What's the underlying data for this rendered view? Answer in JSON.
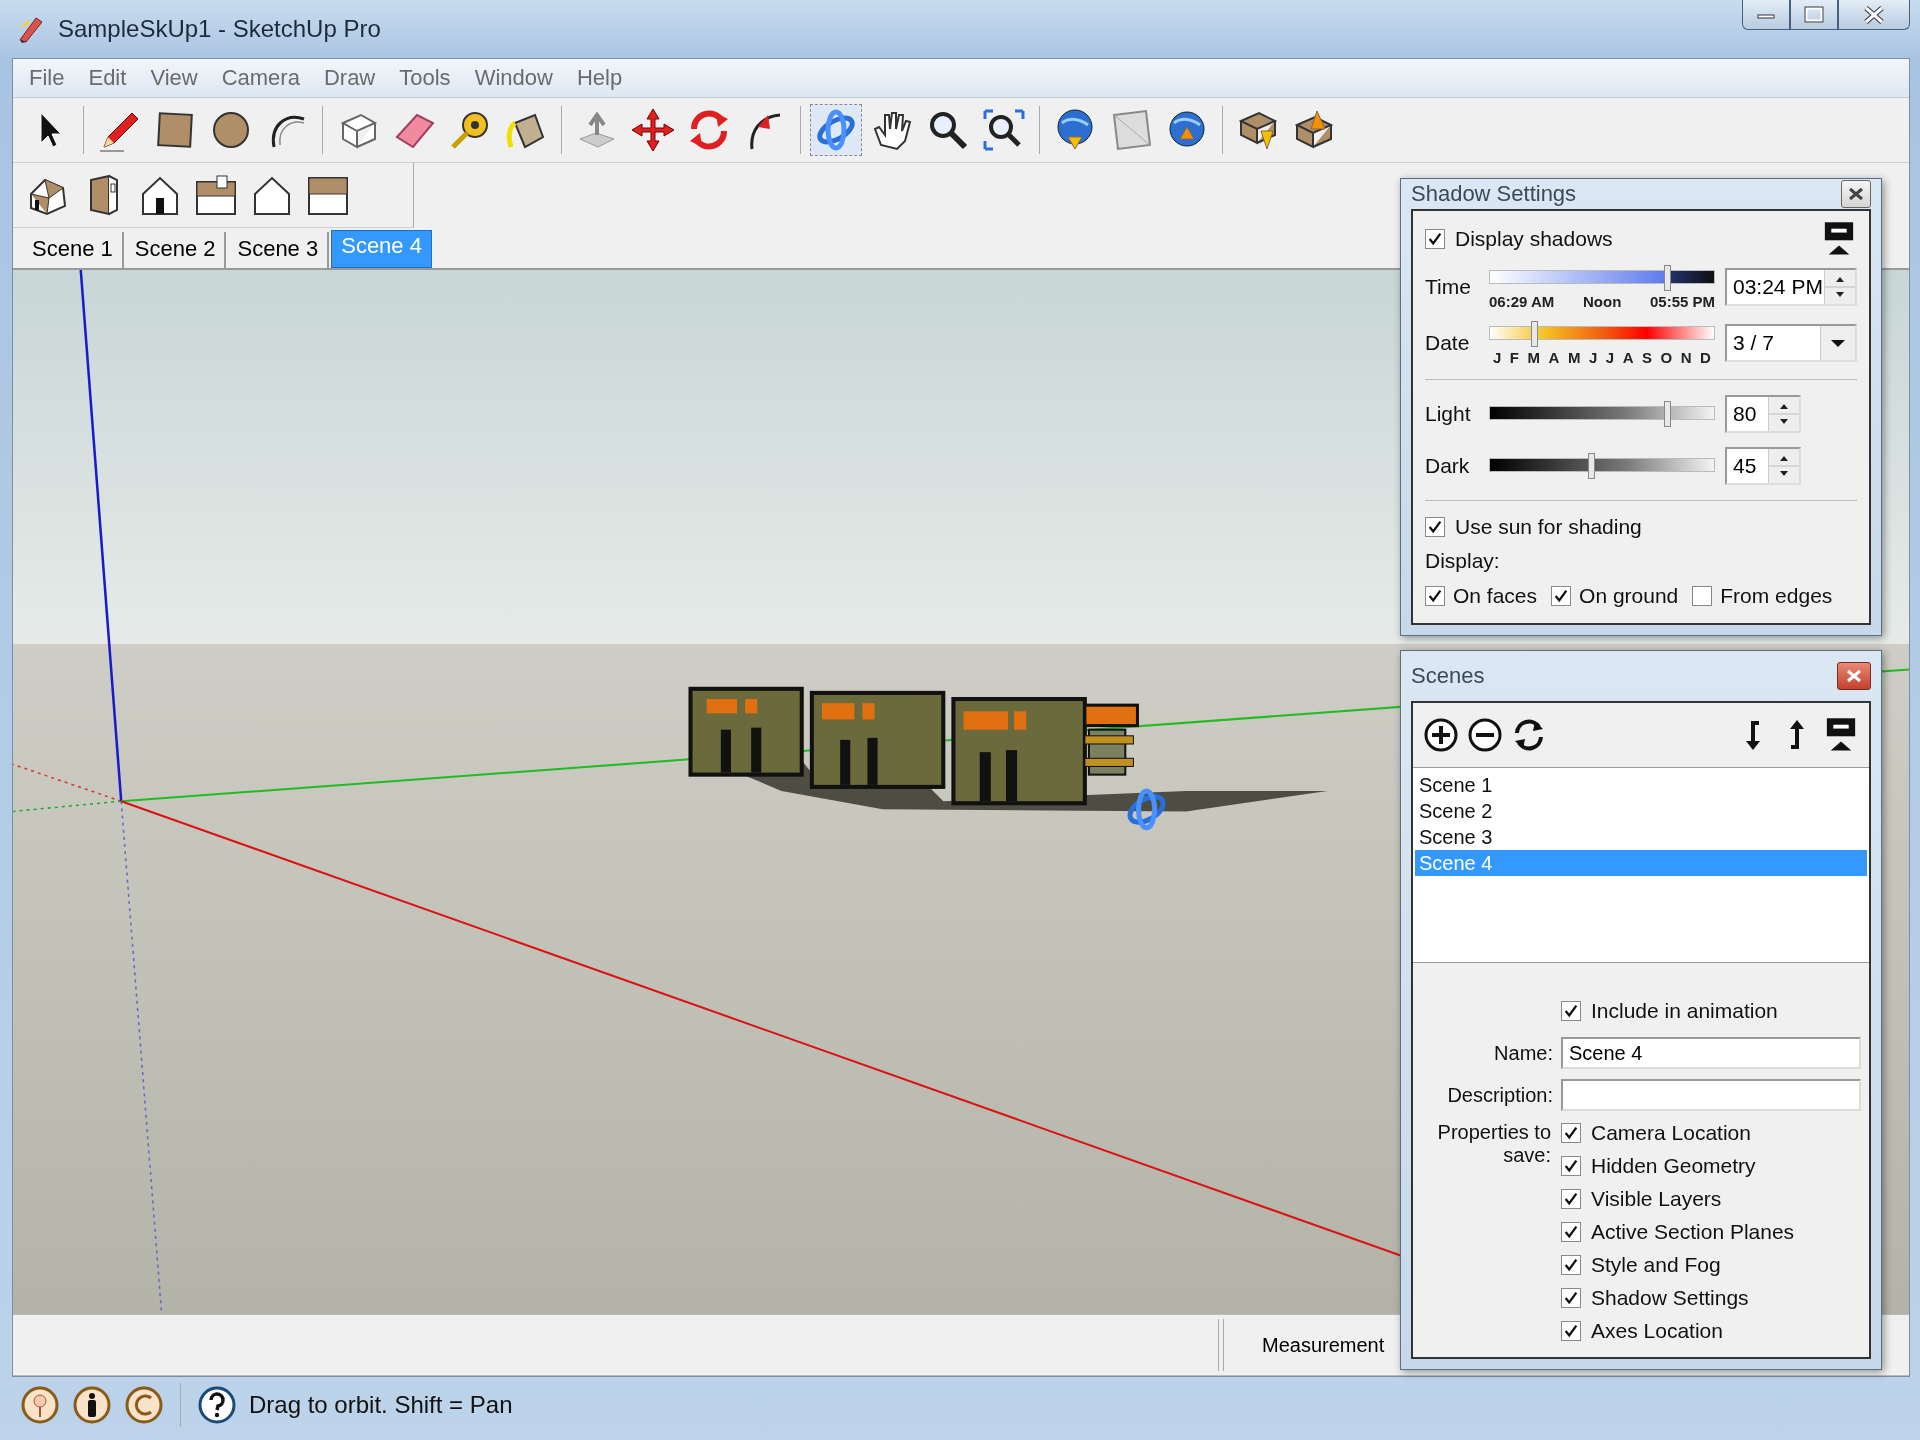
{
  "window": {
    "title": "SampleSkUp1 - SketchUp Pro"
  },
  "menu": [
    "File",
    "Edit",
    "View",
    "Camera",
    "Draw",
    "Tools",
    "Window",
    "Help"
  ],
  "scene_tabs": [
    {
      "label": "Scene 1",
      "selected": false
    },
    {
      "label": "Scene 2",
      "selected": false
    },
    {
      "label": "Scene 3",
      "selected": false
    },
    {
      "label": "Scene 4",
      "selected": true
    }
  ],
  "measurements": {
    "label": "Measurement"
  },
  "status_bar": {
    "message": "Drag to orbit.  Shift = Pan"
  },
  "shadow_settings": {
    "title": "Shadow Settings",
    "display_shadows": {
      "label": "Display shadows",
      "checked": true
    },
    "time": {
      "label": "Time",
      "level": 0.8,
      "marks": [
        "06:29 AM",
        "Noon",
        "05:55 PM"
      ],
      "value": "03:24 PM"
    },
    "date": {
      "label": "Date",
      "level": 0.19,
      "months": [
        "J",
        "F",
        "M",
        "A",
        "M",
        "J",
        "J",
        "A",
        "S",
        "O",
        "N",
        "D"
      ],
      "value": "3 / 7"
    },
    "light": {
      "label": "Light",
      "level": 0.8,
      "value": "80"
    },
    "dark": {
      "label": "Dark",
      "level": 0.45,
      "value": "45"
    },
    "use_sun": {
      "label": "Use sun for shading",
      "checked": true
    },
    "display_label": "Display:",
    "display_options": [
      {
        "label": "On faces",
        "checked": true
      },
      {
        "label": "On ground",
        "checked": true
      },
      {
        "label": "From edges",
        "checked": false
      }
    ]
  },
  "scenes_panel": {
    "title": "Scenes",
    "items": [
      {
        "label": "Scene 1",
        "selected": false
      },
      {
        "label": "Scene 2",
        "selected": false
      },
      {
        "label": "Scene 3",
        "selected": false
      },
      {
        "label": "Scene 4",
        "selected": true
      }
    ],
    "include_in_animation": {
      "label": "Include in animation",
      "checked": true
    },
    "name_label": "Name:",
    "name_value": "Scene 4",
    "description_label": "Description:",
    "properties_label": "Properties to save:",
    "properties": [
      {
        "label": "Camera Location",
        "checked": true
      },
      {
        "label": "Hidden Geometry",
        "checked": true
      },
      {
        "label": "Visible Layers",
        "checked": true
      },
      {
        "label": "Active Section Planes",
        "checked": true
      },
      {
        "label": "Style and Fog",
        "checked": true
      },
      {
        "label": "Shadow Settings",
        "checked": true
      },
      {
        "label": "Axes Location",
        "checked": true
      }
    ]
  }
}
